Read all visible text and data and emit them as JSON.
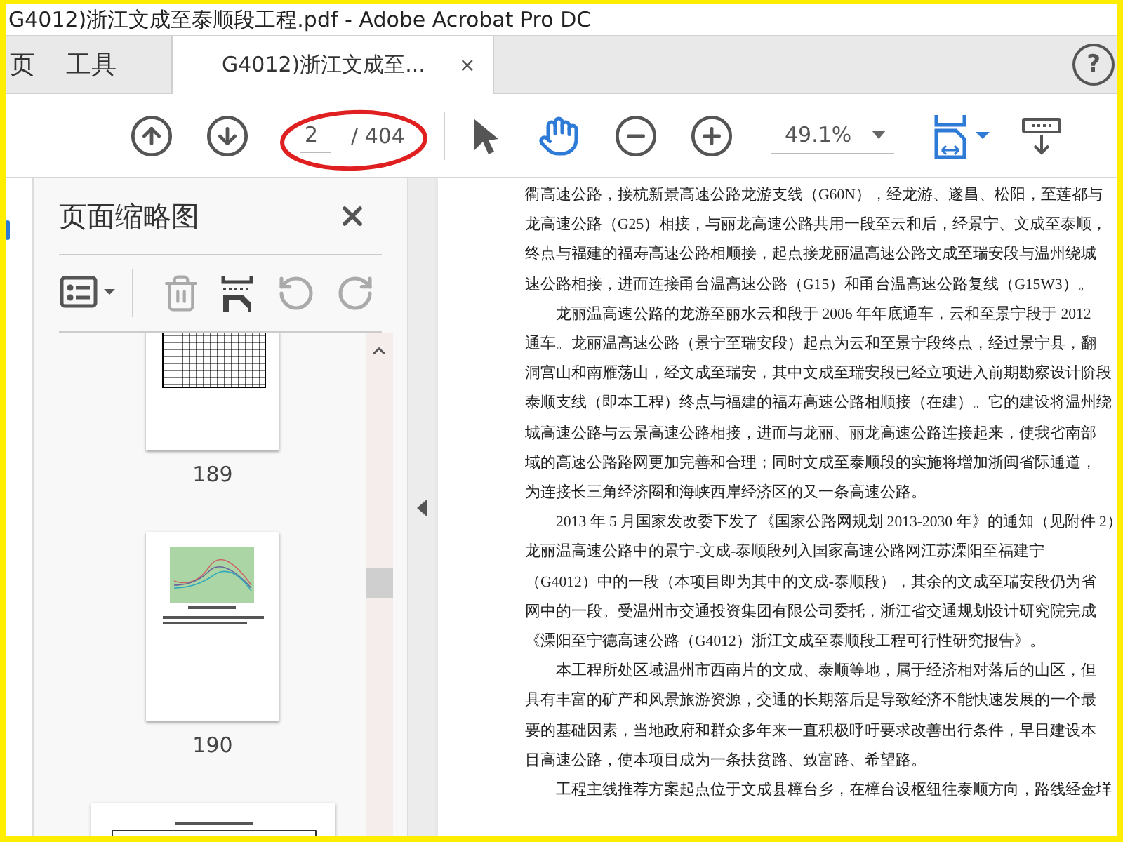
{
  "title_bar": {
    "title": "G4012)浙江文成至泰顺段工程.pdf - Adobe Acrobat Pro DC"
  },
  "tabs": [
    {
      "label": "页",
      "kind": "nav",
      "selected": false
    },
    {
      "label": "工具",
      "kind": "nav",
      "selected": false
    },
    {
      "label": "G4012)浙江文成至...",
      "kind": "document",
      "selected": true,
      "close": "×"
    }
  ],
  "help": "?",
  "toolbar": {
    "page_current": "2",
    "page_total": "/ 404",
    "zoom": "49.1%",
    "tools": [
      {
        "kind": "select",
        "selected": false
      },
      {
        "kind": "hand",
        "selected": true
      }
    ]
  },
  "sidebar": {
    "title": "页面缩略图",
    "thumbnails": [
      {
        "kind": "table",
        "page": "189"
      },
      {
        "kind": "chart",
        "page": "190"
      },
      {
        "kind": "table-wide"
      }
    ]
  },
  "document": {
    "paragraphs": [
      {
        "indent": false,
        "lines": [
          "衢高速公路，接杭新景高速公路龙游支线（G60N），经龙游、遂昌、松阳，至莲都与",
          "龙高速公路（G25）相接，与丽龙高速公路共用一段至云和后，经景宁、文成至泰顺，",
          "终点与福建的福寿高速公路相顺接，起点接龙丽温高速公路文成至瑞安段与温州绕城",
          "速公路相接，进而连接甬台温高速公路（G15）和甬台温高速公路复线（G15W3）。"
        ]
      },
      {
        "indent": true,
        "lines": [
          "龙丽温高速公路的龙游至丽水云和段于 2006 年年底通车，云和至景宁段于 2012",
          "通车。龙丽温高速公路（景宁至瑞安段）起点为云和至景宁段终点，经过景宁县，翻",
          "洞宫山和南雁荡山，经文成至瑞安，其中文成至瑞安段已经立项进入前期勘察设计阶段",
          "泰顺支线（即本工程）终点与福建的福寿高速公路相顺接（在建）。它的建设将温州绕",
          "城高速公路与云景高速公路相接，进而与龙丽、丽龙高速公路连接起来，使我省南部",
          "域的高速公路路网更加完善和合理；同时文成至泰顺段的实施将增加浙闽省际通道，",
          "为连接长三角经济圈和海峡西岸经济区的又一条高速公路。"
        ]
      },
      {
        "indent": true,
        "lines": [
          "2013 年 5 月国家发改委下发了《国家公路网规划 2013-2030 年》的通知（见附件 2）",
          "龙丽温高速公路中的景宁-文成-泰顺段列入国家高速公路网江苏溧阳至福建宁",
          "（G4012）中的一段（本项目即为其中的文成-泰顺段），其余的文成至瑞安段仍为省",
          "网中的一段。受温州市交通投资集团有限公司委托，浙江省交通规划设计研究院完成",
          "《溧阳至宁德高速公路（G4012）浙江文成至泰顺段工程可行性研究报告》。"
        ]
      },
      {
        "indent": true,
        "lines": [
          "本工程所处区域温州市西南片的文成、泰顺等地，属于经济相对落后的山区，但",
          "具有丰富的矿产和风景旅游资源，交通的长期落后是导致经济不能快速发展的一个最",
          "要的基础因素，当地政府和群众多年来一直积极呼吁要求改善出行条件，早日建设本",
          "目高速公路，使本项目成为一条扶贫路、致富路、希望路。"
        ]
      },
      {
        "indent": true,
        "lines": [
          "工程主线推荐方案起点位于文成县樟台乡，在樟台设枢纽往泰顺方向，路线经金垟"
        ]
      }
    ]
  }
}
